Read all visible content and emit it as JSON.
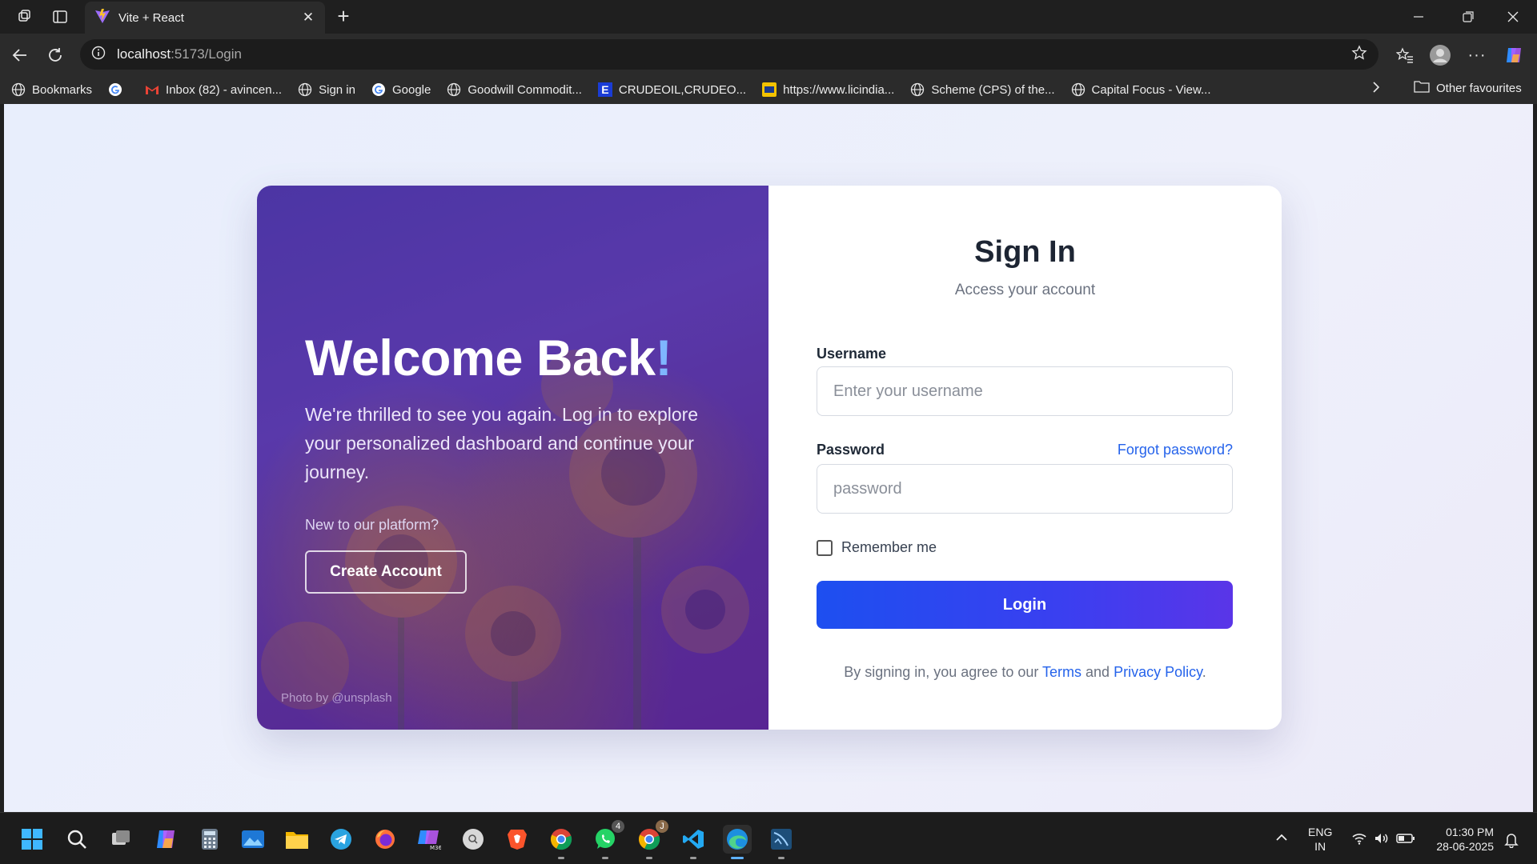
{
  "browser": {
    "tab_title": "Vite + React",
    "url_host": "localhost",
    "url_path": ":5173/Login",
    "bookmarks": [
      {
        "label": "Bookmarks",
        "icon": "globe-icon"
      },
      {
        "label": "",
        "icon": "google-icon"
      },
      {
        "label": "Inbox (82) - avincen...",
        "icon": "gmail-icon"
      },
      {
        "label": "Sign in",
        "icon": "globe-icon"
      },
      {
        "label": "Google",
        "icon": "google-icon"
      },
      {
        "label": "Goodwill Commodit...",
        "icon": "globe-icon"
      },
      {
        "label": "CRUDEOIL,CRUDEO...",
        "icon": "e-icon"
      },
      {
        "label": "https://www.licindia...",
        "icon": "lic-icon"
      },
      {
        "label": "Scheme (CPS) of the...",
        "icon": "globe-icon"
      },
      {
        "label": "Capital Focus - View...",
        "icon": "globe-icon"
      }
    ],
    "other_favourites": "Other favourites"
  },
  "hero": {
    "title": "Welcome Back",
    "title_mark": "!",
    "text": "We're thrilled to see you again. Log in to explore your personalized dashboard and continue your journey.",
    "new_prompt": "New to our platform?",
    "create_button": "Create Account",
    "photo_credit": "Photo by @unsplash"
  },
  "form": {
    "title": "Sign In",
    "subtitle": "Access your account",
    "username_label": "Username",
    "username_placeholder": "Enter your username",
    "password_label": "Password",
    "password_placeholder": "password",
    "forgot_link": "Forgot password?",
    "remember_label": "Remember me",
    "remember_checked": false,
    "login_button": "Login",
    "terms_prefix": "By signing in, you agree to our ",
    "terms_link": "Terms",
    "terms_and": " and ",
    "privacy_link": "Privacy Policy",
    "terms_suffix": "."
  },
  "taskbar": {
    "apps": [
      "start-icon",
      "search-icon",
      "task-view-icon",
      "copilot-icon",
      "calculator-icon",
      "photos-icon",
      "file-explorer-icon",
      "telegram-icon",
      "firefox-icon",
      "m365-icon",
      "search-app-icon",
      "brave-icon",
      "chrome-icon",
      "whatsapp-icon",
      "chrome-profile-icon",
      "vscode-icon",
      "edge-icon",
      "sql-tool-icon"
    ],
    "whatsapp_badge": "4",
    "chrome_profile_badge": "J",
    "language_line1": "ENG",
    "language_line2": "IN",
    "time": "01:30 PM",
    "date": "28-06-2025"
  },
  "colors": {
    "accent_blue": "#2563eb",
    "login_gradient_start": "#1d4ff0",
    "login_gradient_end": "#5a35e8",
    "hero_purple": "#5c3fae"
  }
}
